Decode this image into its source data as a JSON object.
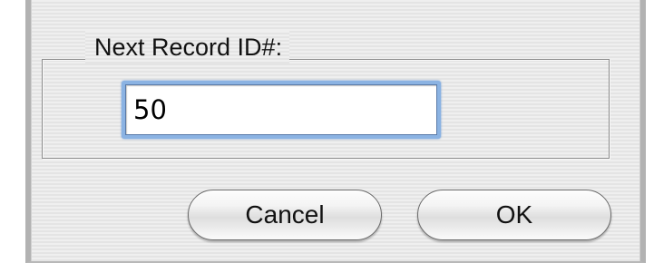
{
  "dialog": {
    "group_label": "Next Record ID#:",
    "field": {
      "value": "50"
    },
    "buttons": {
      "cancel_label": "Cancel",
      "ok_label": "OK"
    }
  }
}
